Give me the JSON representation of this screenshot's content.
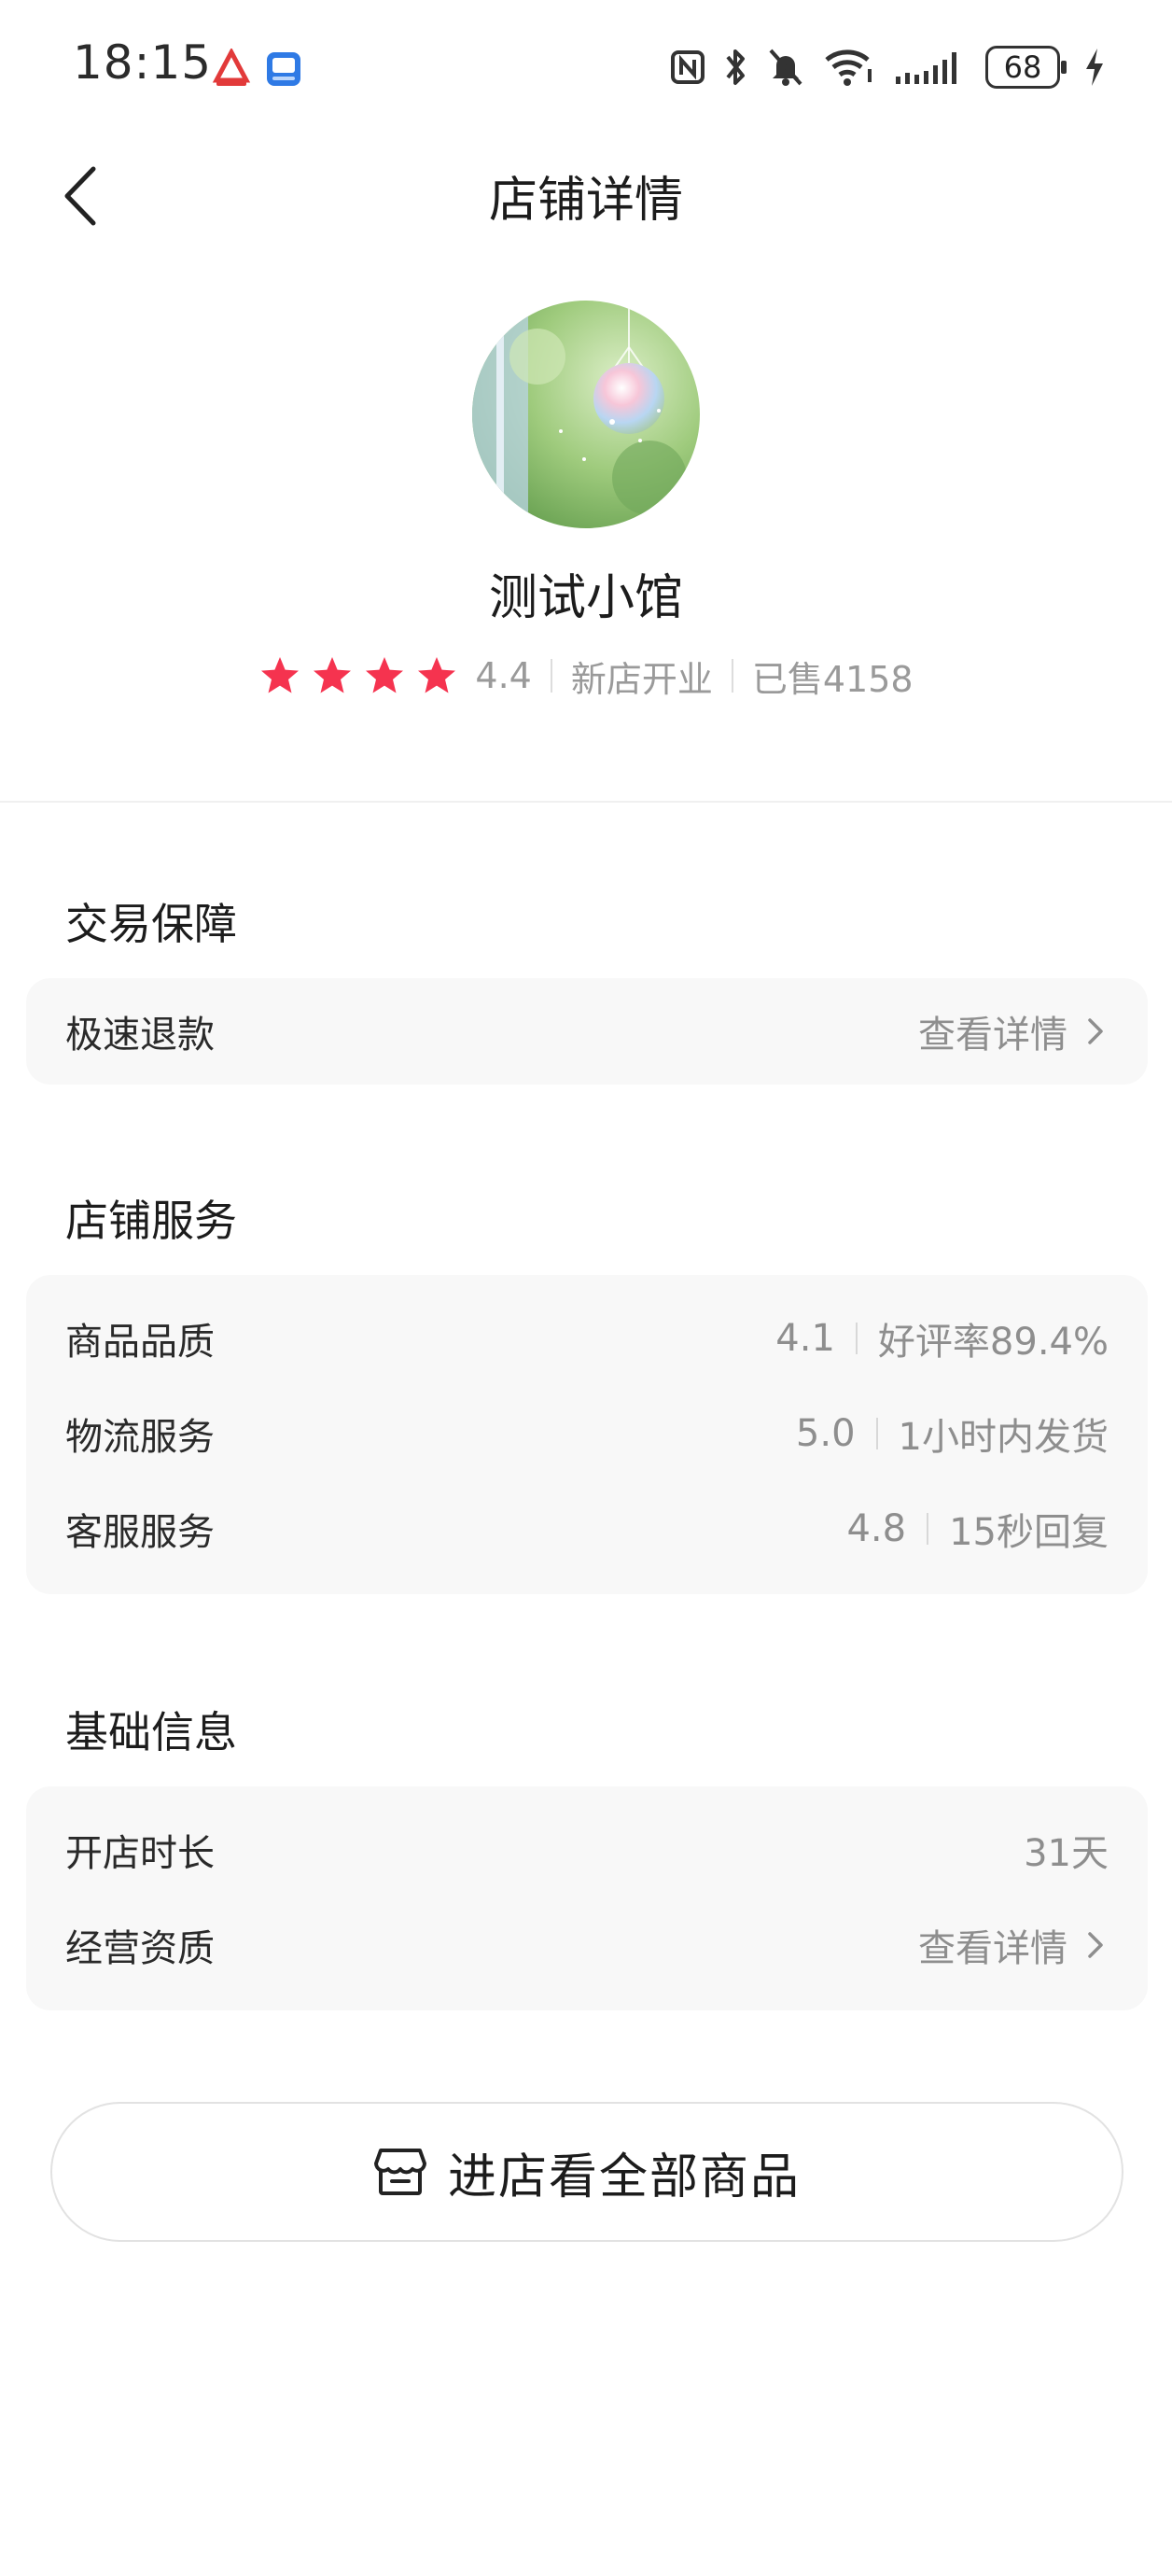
{
  "status_bar": {
    "time": "18:15",
    "battery": "68",
    "icons": [
      "app-icon-red",
      "app-icon-blue",
      "nfc-icon",
      "bluetooth-icon",
      "mute-icon",
      "wifi-icon",
      "signal-icon",
      "battery-icon",
      "charging-icon"
    ]
  },
  "nav": {
    "title": "店铺详情",
    "back_icon": "chevron-left-icon"
  },
  "store": {
    "name": "测试小馆",
    "rating": "4.4",
    "stars": 4,
    "tag": "新店开业",
    "sold": "已售4158",
    "star_color": "#f5334f"
  },
  "trade_guarantee": {
    "title": "交易保障",
    "rows": [
      {
        "label": "极速退款",
        "link": "查看详情"
      }
    ]
  },
  "store_service": {
    "title": "店铺服务",
    "rows": [
      {
        "label": "商品品质",
        "score": "4.1",
        "desc": "好评率89.4%"
      },
      {
        "label": "物流服务",
        "score": "5.0",
        "desc": "1小时内发货"
      },
      {
        "label": "客服服务",
        "score": "4.8",
        "desc": "15秒回复"
      }
    ]
  },
  "basic_info": {
    "title": "基础信息",
    "rows": [
      {
        "label": "开店时长",
        "value": "31天"
      },
      {
        "label": "经营资质",
        "link": "查看详情"
      }
    ]
  },
  "enter_store": {
    "label": "进店看全部商品",
    "icon": "store-icon"
  }
}
